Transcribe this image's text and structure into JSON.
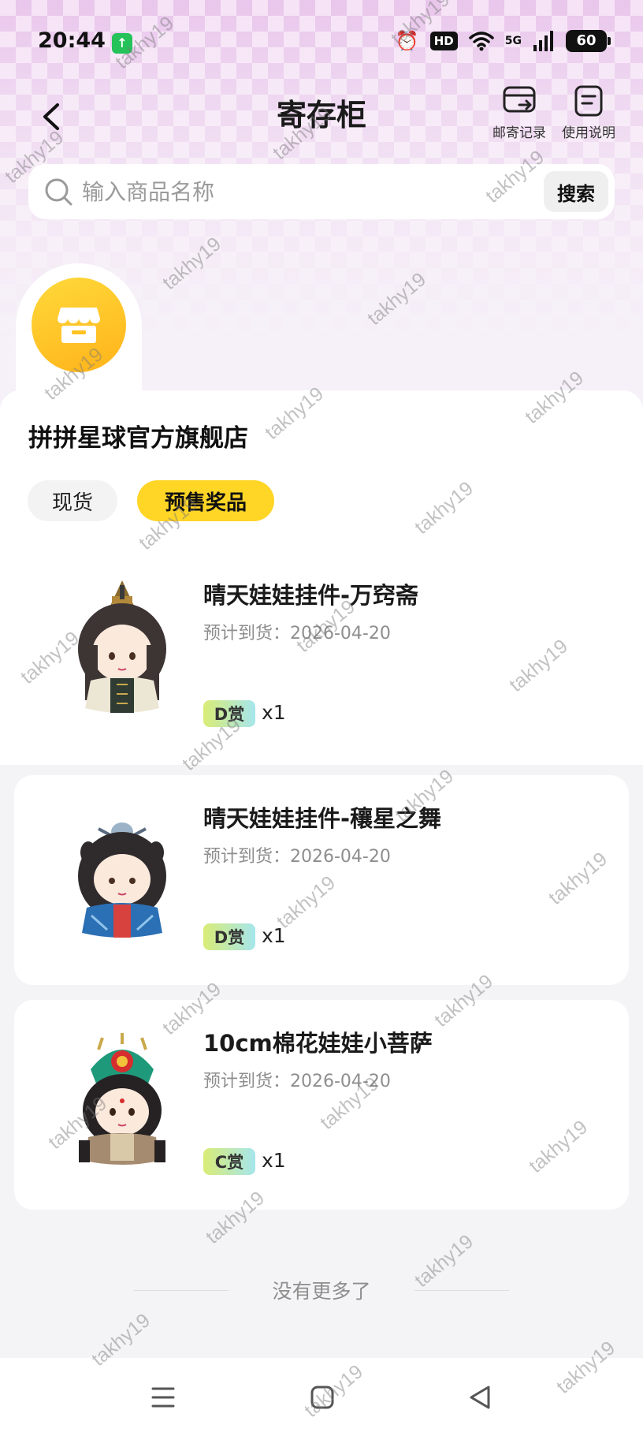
{
  "status_bar": {
    "time": "20:44",
    "hd": "HD",
    "network": "5G",
    "battery": "60"
  },
  "header": {
    "title": "寄存柜",
    "mail_record_label": "邮寄记录",
    "guide_label": "使用说明"
  },
  "search": {
    "placeholder": "输入商品名称",
    "value": "",
    "button_label": "搜索"
  },
  "store": {
    "name": "拼拼星球官方旗舰店",
    "tabs": [
      {
        "label": "现货",
        "active": false
      },
      {
        "label": "预售奖品",
        "active": true
      }
    ]
  },
  "products": [
    {
      "name": "晴天娃娃挂件-万窍斋",
      "date": "预计到货：2026-04-20",
      "tier": "D赏",
      "qty": "x1"
    },
    {
      "name": "晴天娃娃挂件-穰星之舞",
      "date": "预计到货：2026-04-20",
      "tier": "D赏",
      "qty": "x1"
    },
    {
      "name": "10cm棉花娃娃小菩萨",
      "date": "预计到货：2026-04-20",
      "tier": "C赏",
      "qty": "x1"
    }
  ],
  "list_end_text": "没有更多了",
  "watermark_text": "takhy19",
  "colors": {
    "accent": "#ffd526",
    "logo": "#ffc21f",
    "badge_start": "#d9ec76",
    "badge_end": "#a6e6ec"
  }
}
